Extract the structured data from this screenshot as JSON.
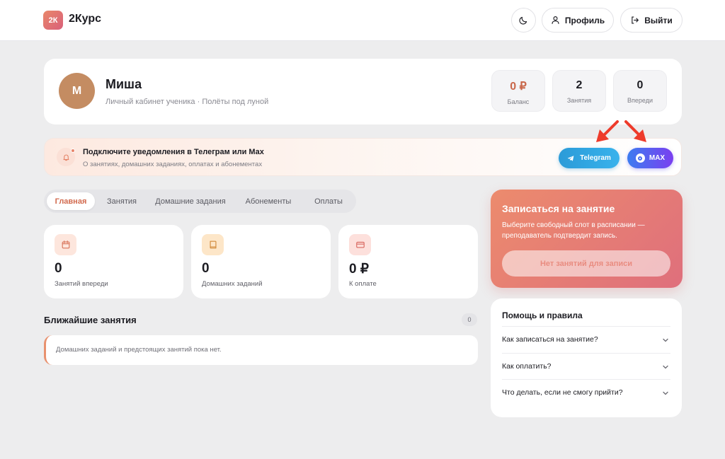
{
  "header": {
    "logo_badge": "2К",
    "logo_text": "2Курс",
    "theme_icon": "moon-icon",
    "profile_label": "Профиль",
    "logout_label": "Выйти"
  },
  "profile": {
    "avatar_letter": "М",
    "name": "Миша",
    "subtitle": "Личный кабинет ученика · Полёты под луной",
    "stats": [
      {
        "value": "0 ₽",
        "label": "Баланс"
      },
      {
        "value": "2",
        "label": "Занятия"
      },
      {
        "value": "0",
        "label": "Впереди"
      }
    ]
  },
  "notify": {
    "title": "Подключите уведомления в Телеграм или Max",
    "subtitle": "О занятиях, домашних заданиях, оплатах и абонементах",
    "telegram_label": "Telegram",
    "max_label": "MAX"
  },
  "tabs": [
    "Главная",
    "Занятия",
    "Домашние задания",
    "Абонементы",
    "Оплаты"
  ],
  "cards": [
    {
      "value": "0",
      "label": "Занятий впереди",
      "icon": "calendar-icon"
    },
    {
      "value": "0",
      "label": "Домашних заданий",
      "icon": "book-icon"
    },
    {
      "value": "0 ₽",
      "label": "К оплате",
      "icon": "card-icon"
    }
  ],
  "upcoming": {
    "title": "Ближайшие занятия",
    "count": "0",
    "empty_text": "Домашних заданий и предстоящих занятий пока нет."
  },
  "booking": {
    "title": "Записаться на занятие",
    "subtitle": "Выберите свободный слот в расписании — преподаватель подтвердит запись.",
    "button_label": "Нет занятий для записи"
  },
  "help": {
    "title": "Помощь и правила",
    "faq": [
      "Как записаться на занятие?",
      "Как оплатить?",
      "Что делать, если не смогу прийти?"
    ]
  },
  "colors": {
    "accent": "#d26a4e",
    "telegram": "#2b9bd8",
    "max": "#6a4ff0",
    "annotation_arrow": "#ee3b2b"
  }
}
